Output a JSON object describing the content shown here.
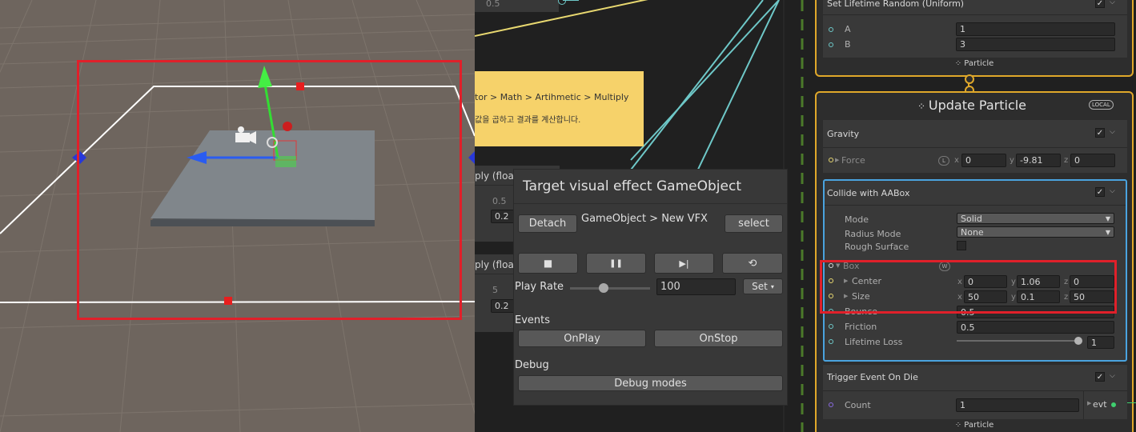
{
  "colors": {
    "sticky": "#f6d26a",
    "context_border": "#e0a82a",
    "selected_block": "#4aa3df",
    "highlight": "#e0202a",
    "flow_line": "#e8d870",
    "link_line": "#6ec8c8"
  },
  "graph": {
    "frag_top": {
      "value": "0.5"
    },
    "sticky": {
      "line1": "tor > Math > Artihmetic > Multiply",
      "line2": "값을 곱하고 결과를 계산합니다."
    },
    "node1": {
      "title": "ply (float",
      "ghost": "0.5",
      "value": "0.2"
    },
    "node2": {
      "title": "ply (float",
      "ghost": "5",
      "value": "0.2"
    }
  },
  "target_panel": {
    "title": "Target visual effect GameObject",
    "detach": "Detach",
    "path": "GameObject > New VFX",
    "select": "select",
    "controls": [
      {
        "icon": "stop-icon",
        "glyph": "■"
      },
      {
        "icon": "pause-icon",
        "glyph": "❚❚"
      },
      {
        "icon": "step-icon",
        "glyph": "▶|"
      },
      {
        "icon": "restart-icon",
        "glyph": "⟲"
      }
    ],
    "play_rate_label": "Play Rate",
    "play_rate": "100",
    "play_rate_fraction": 0.42,
    "set": "Set",
    "events_label": "Events",
    "onplay": "OnPlay",
    "onstop": "OnStop",
    "debug_label": "Debug",
    "debug_modes": "Debug modes"
  },
  "init_context": {
    "block_title": "Set Lifetime Random (Uniform)",
    "a_label": "A",
    "a_value": "1",
    "b_label": "B",
    "b_value": "3",
    "footer": "Particle"
  },
  "update_context": {
    "title": "Update Particle",
    "badge": "LOCAL",
    "gravity": {
      "title": "Gravity",
      "force_label": "Force",
      "space": "L",
      "x": "0",
      "y": "-9.81",
      "z": "0"
    },
    "collide": {
      "title": "Collide with AABox",
      "mode_label": "Mode",
      "mode": "Solid",
      "radius_label": "Radius Mode",
      "radius": "None",
      "rough_label": "Rough Surface",
      "box_label": "Box",
      "space": "W",
      "center_label": "Center",
      "center": {
        "x": "0",
        "y": "1.06",
        "z": "0"
      },
      "size_label": "Size",
      "size": {
        "x": "50",
        "y": "0.1",
        "z": "50"
      },
      "bounce_label": "Bounce",
      "bounce": "0.5",
      "friction_label": "Friction",
      "friction": "0.5",
      "lifetime_loss_label": "Lifetime Loss",
      "lifetime_loss": "1",
      "lifetime_loss_fraction": 1.0
    },
    "trigger": {
      "title": "Trigger Event On Die",
      "count_label": "Count",
      "count": "1",
      "evt": "evt"
    },
    "footer": "Particle"
  },
  "axis_labels": {
    "x": "x",
    "y": "y",
    "z": "z"
  }
}
